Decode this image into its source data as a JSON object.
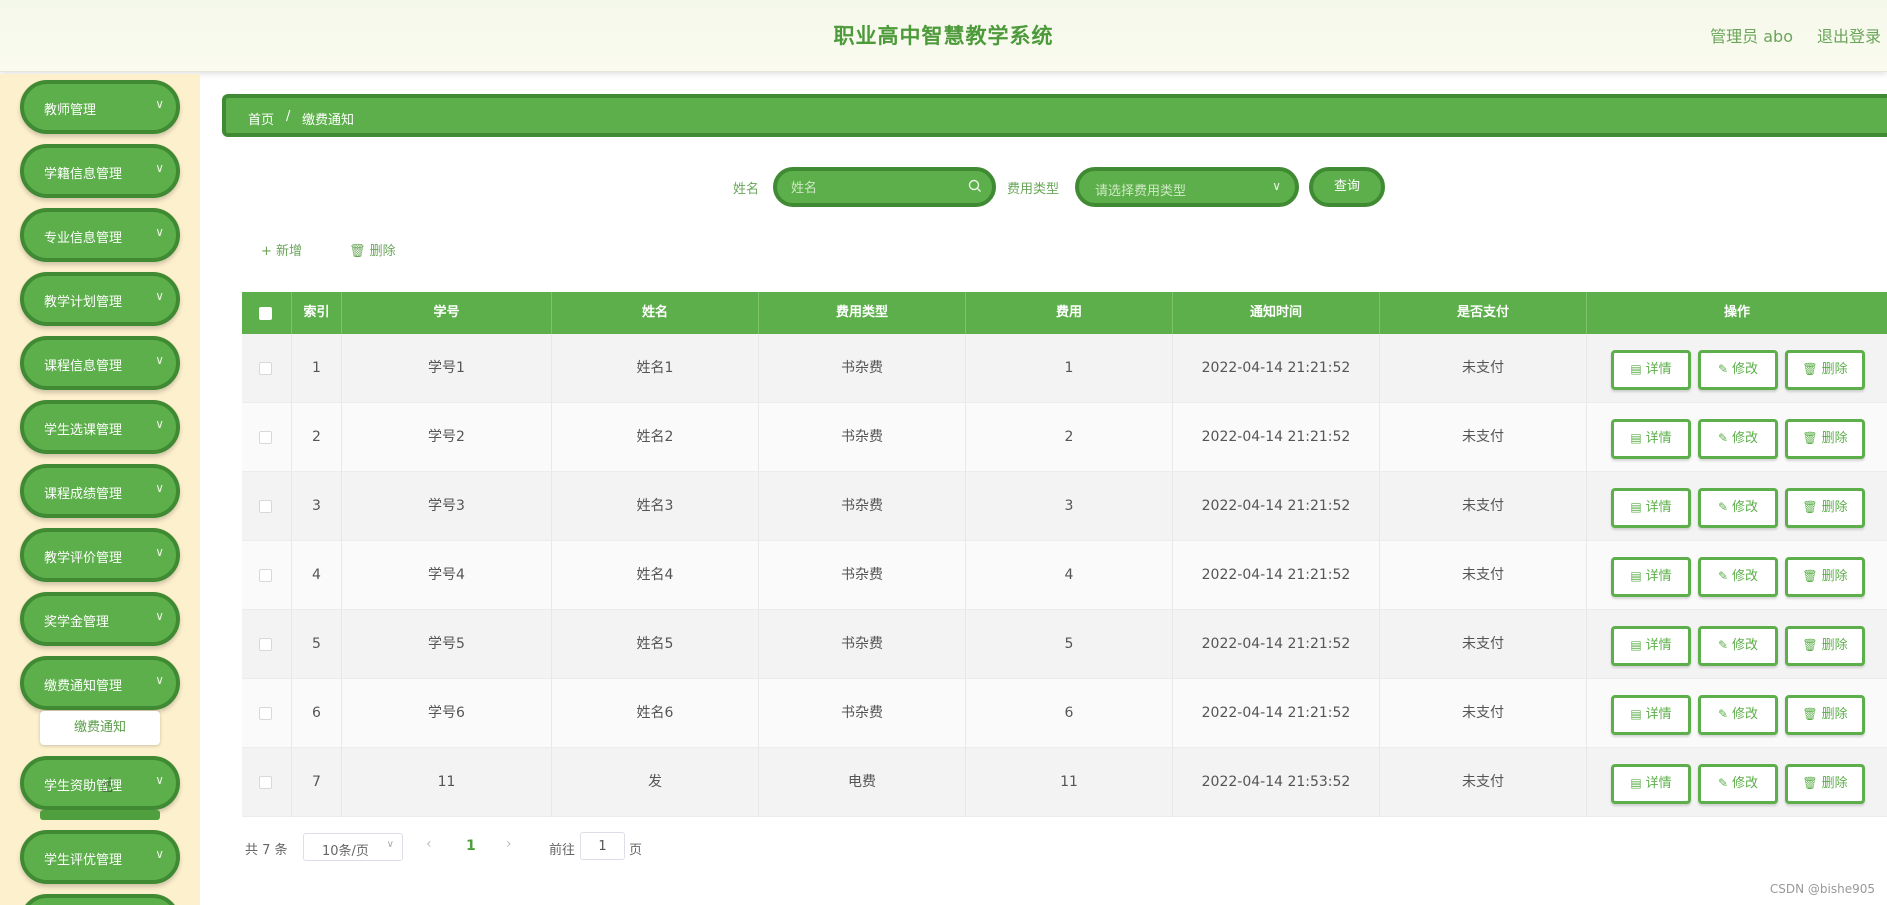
{
  "header": {
    "title": "职业高中智慧教学系统",
    "user": "管理员 abo",
    "logout": "退出登录"
  },
  "sidebar": {
    "items": [
      {
        "label": "教师管理"
      },
      {
        "label": "学籍信息管理"
      },
      {
        "label": "专业信息管理"
      },
      {
        "label": "教学计划管理"
      },
      {
        "label": "课程信息管理"
      },
      {
        "label": "学生选课管理"
      },
      {
        "label": "课程成绩管理"
      },
      {
        "label": "教学评价管理"
      },
      {
        "label": "奖学金管理"
      },
      {
        "label": "缴费通知管理"
      },
      {
        "label": "学生资助管理"
      },
      {
        "label": "学生评优管理"
      }
    ],
    "submenu": "缴费通知"
  },
  "breadcrumb": {
    "home": "首页",
    "separator": "/",
    "current": "缴费通知"
  },
  "search": {
    "name_label": "姓名",
    "name_placeholder": "姓名",
    "type_label": "费用类型",
    "type_placeholder": "请选择费用类型",
    "query": "查询"
  },
  "toolbar": {
    "add": "新增",
    "delete": "删除"
  },
  "table": {
    "headers": [
      "索引",
      "学号",
      "姓名",
      "费用类型",
      "费用",
      "通知时间",
      "是否支付",
      "操作"
    ],
    "rows": [
      {
        "index": "1",
        "id": "学号1",
        "name": "姓名1",
        "type": "书杂费",
        "fee": "1",
        "time": "2022-04-14 21:21:52",
        "paid": "未支付"
      },
      {
        "index": "2",
        "id": "学号2",
        "name": "姓名2",
        "type": "书杂费",
        "fee": "2",
        "time": "2022-04-14 21:21:52",
        "paid": "未支付"
      },
      {
        "index": "3",
        "id": "学号3",
        "name": "姓名3",
        "type": "书杂费",
        "fee": "3",
        "time": "2022-04-14 21:21:52",
        "paid": "未支付"
      },
      {
        "index": "4",
        "id": "学号4",
        "name": "姓名4",
        "type": "书杂费",
        "fee": "4",
        "time": "2022-04-14 21:21:52",
        "paid": "未支付"
      },
      {
        "index": "5",
        "id": "学号5",
        "name": "姓名5",
        "type": "书杂费",
        "fee": "5",
        "time": "2022-04-14 21:21:52",
        "paid": "未支付"
      },
      {
        "index": "6",
        "id": "学号6",
        "name": "姓名6",
        "type": "书杂费",
        "fee": "6",
        "time": "2022-04-14 21:21:52",
        "paid": "未支付"
      },
      {
        "index": "7",
        "id": "11",
        "name": "发",
        "type": "电费",
        "fee": "11",
        "time": "2022-04-14 21:53:52",
        "paid": "未支付"
      }
    ],
    "actions": {
      "detail": "详情",
      "edit": "修改",
      "delete": "删除"
    }
  },
  "pagination": {
    "total": "共 7 条",
    "page_size": "10条/页",
    "current": "1",
    "goto_label": "前往",
    "goto_value": "1",
    "page_suffix": "页"
  },
  "watermark": "CSDN @bishe905",
  "colors": {
    "primary": "#5caf4a",
    "border": "#3f8a33",
    "sidebar_bg": "#fdf0cd"
  }
}
